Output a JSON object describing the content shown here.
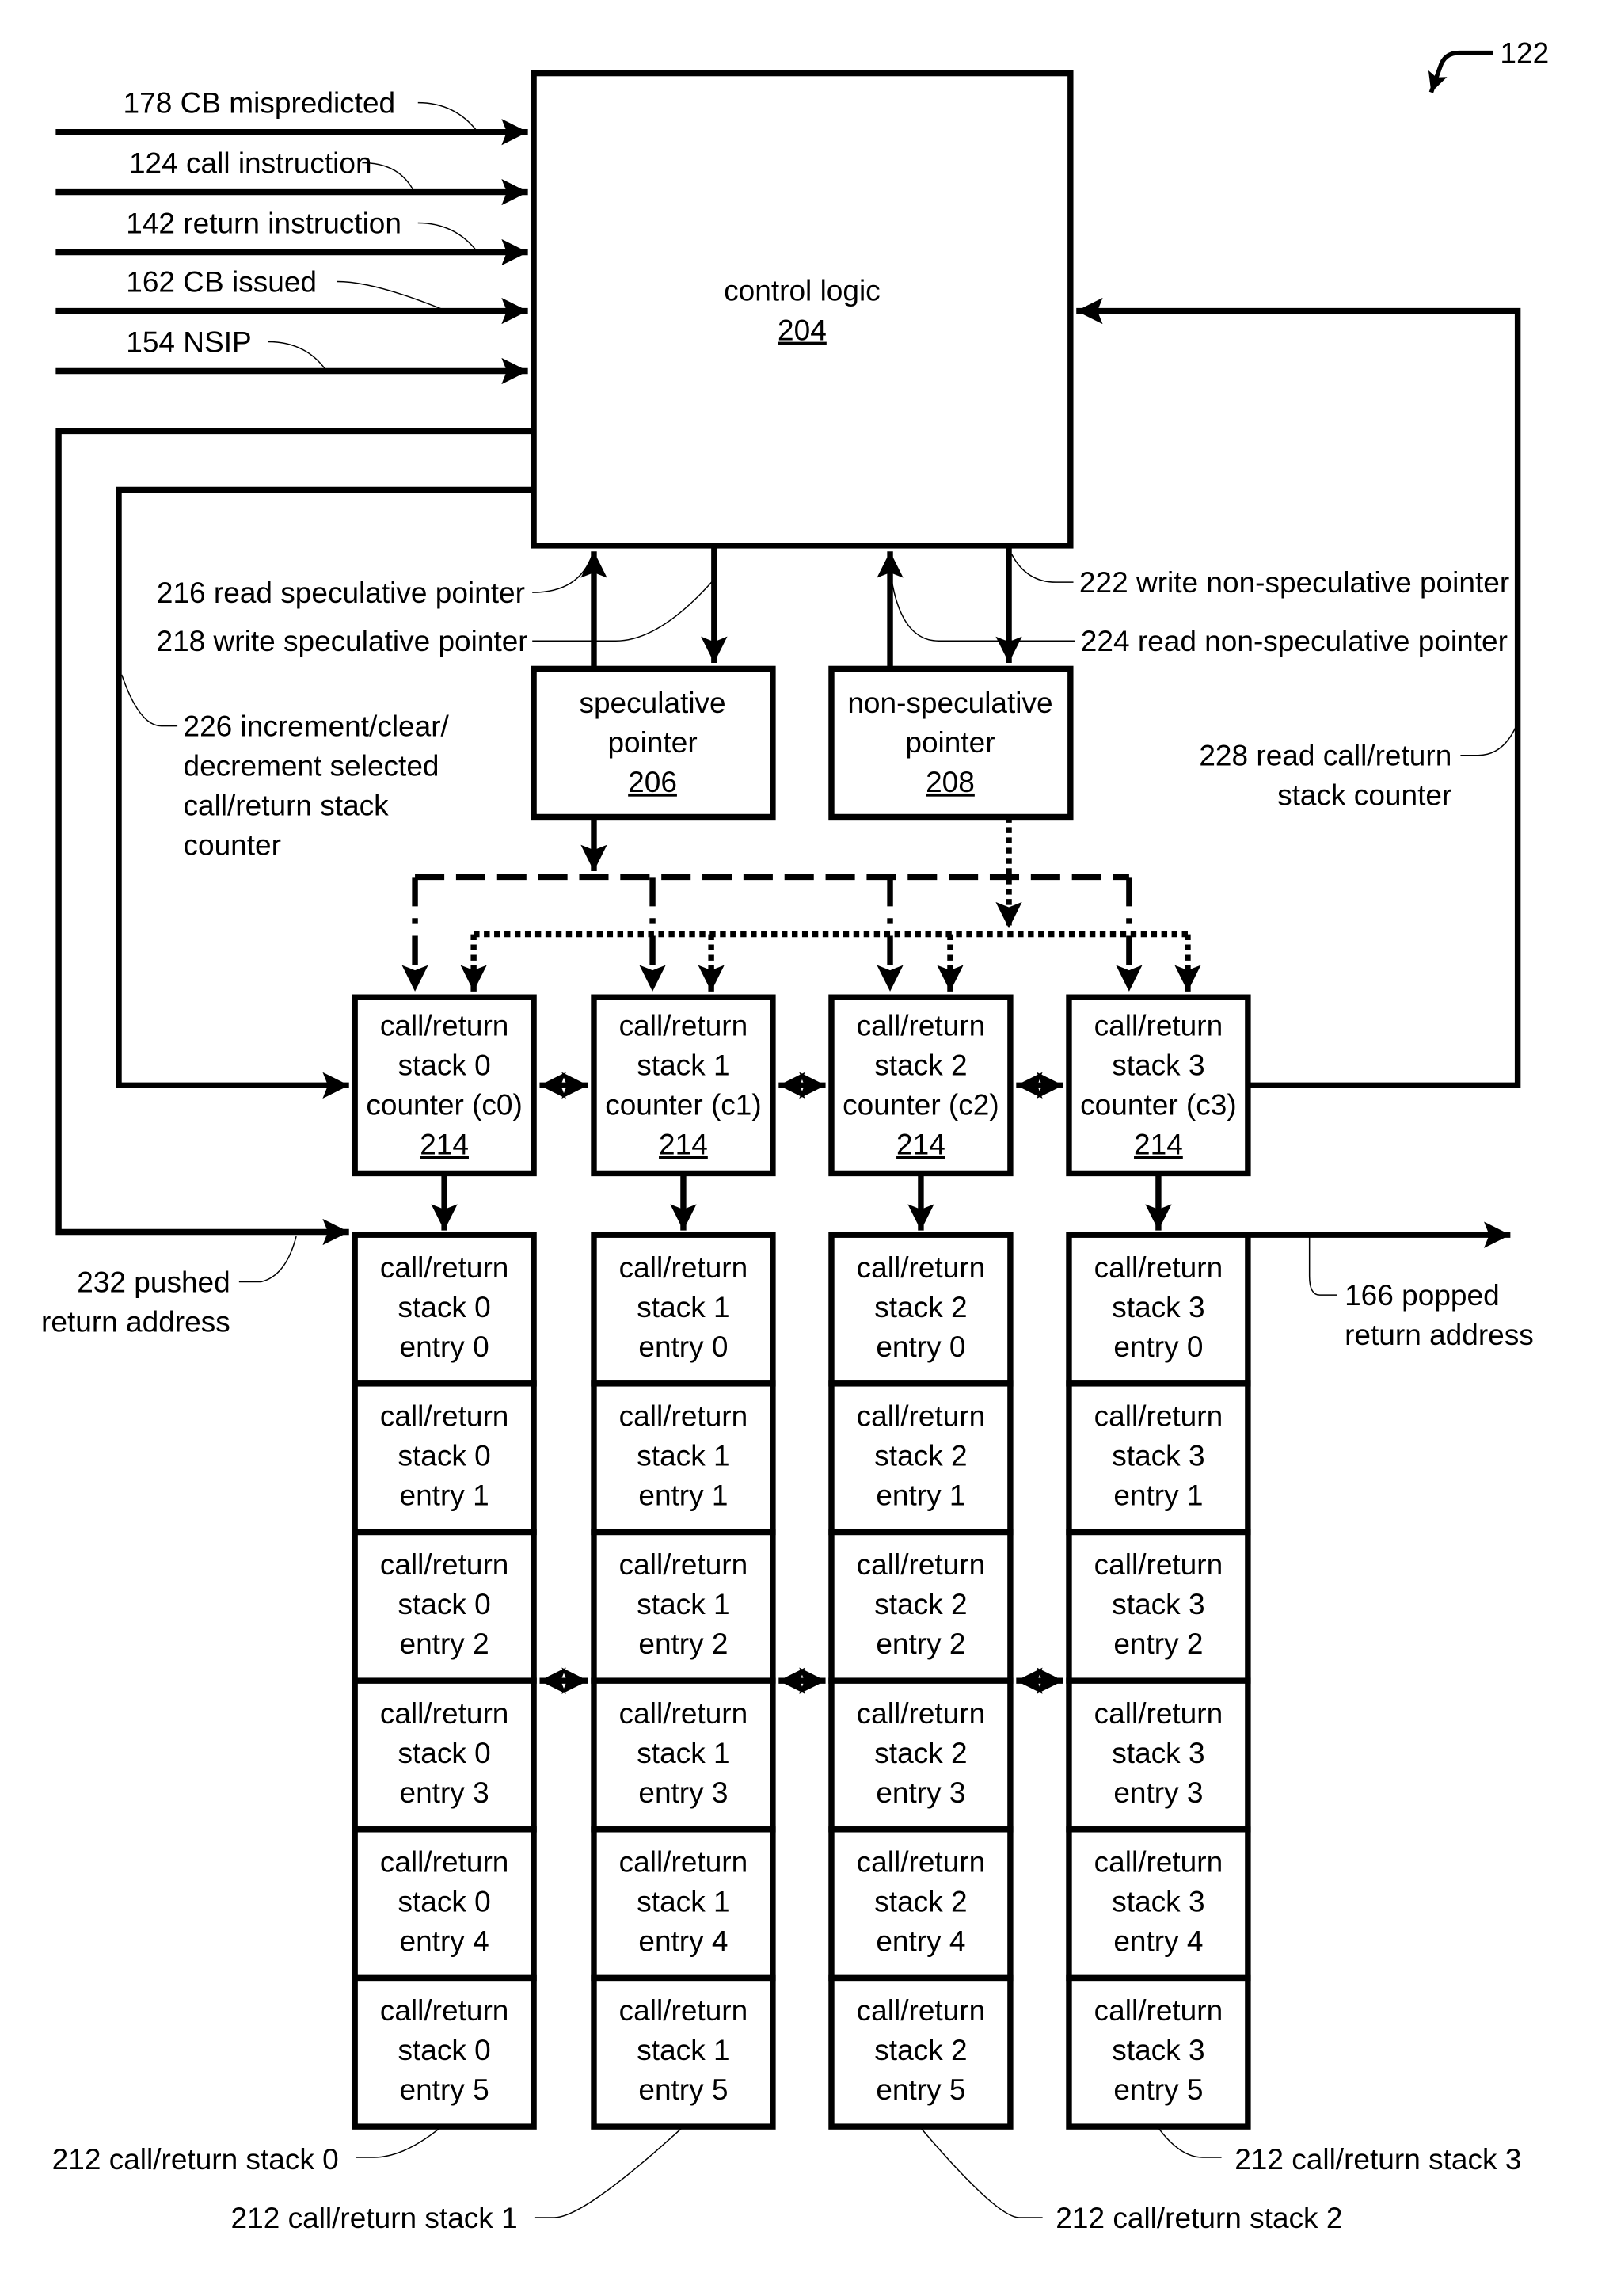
{
  "figure_ref": "122",
  "inputs": [
    {
      "ref": "178",
      "label": "178 CB mispredicted"
    },
    {
      "ref": "124",
      "label": "124 call instruction"
    },
    {
      "ref": "142",
      "label": "142 return instruction"
    },
    {
      "ref": "162",
      "label": "162 CB issued"
    },
    {
      "ref": "154",
      "label": "154 NSIP"
    }
  ],
  "control_logic": {
    "title": "control logic",
    "ref": "204"
  },
  "speculative_pointer": {
    "line1": "speculative",
    "line2": "pointer",
    "ref": "206"
  },
  "non_speculative_pointer": {
    "line1": "non-speculative",
    "line2": "pointer",
    "ref": "208"
  },
  "signals": {
    "read_spec": "216 read speculative pointer",
    "write_spec": "218 write speculative pointer",
    "write_nonspec": "222 write non-speculative pointer",
    "read_nonspec": "224 read non-speculative pointer",
    "inc_clear_dec": [
      "226 increment/clear/",
      "decrement selected",
      "call/return stack",
      "counter"
    ],
    "read_counter": [
      "228 read call/return",
      "stack counter"
    ],
    "pushed": [
      "232 pushed",
      "return address"
    ],
    "popped": [
      "166 popped",
      "return address"
    ]
  },
  "counters": [
    {
      "line1": "call/return",
      "line2": "stack 0",
      "line3": "counter (c0)",
      "ref": "214"
    },
    {
      "line1": "call/return",
      "line2": "stack 1",
      "line3": "counter (c1)",
      "ref": "214"
    },
    {
      "line1": "call/return",
      "line2": "stack 2",
      "line3": "counter (c2)",
      "ref": "214"
    },
    {
      "line1": "call/return",
      "line2": "stack 3",
      "line3": "counter (c3)",
      "ref": "214"
    }
  ],
  "stacks": [
    {
      "label": "212 call/return stack 0",
      "entries": [
        [
          "call/return",
          "stack 0",
          "entry 0"
        ],
        [
          "call/return",
          "stack 0",
          "entry 1"
        ],
        [
          "call/return",
          "stack 0",
          "entry 2"
        ],
        [
          "call/return",
          "stack 0",
          "entry 3"
        ],
        [
          "call/return",
          "stack 0",
          "entry 4"
        ],
        [
          "call/return",
          "stack 0",
          "entry 5"
        ]
      ]
    },
    {
      "label": "212 call/return stack 1",
      "entries": [
        [
          "call/return",
          "stack 1",
          "entry 0"
        ],
        [
          "call/return",
          "stack 1",
          "entry 1"
        ],
        [
          "call/return",
          "stack 1",
          "entry 2"
        ],
        [
          "call/return",
          "stack 1",
          "entry 3"
        ],
        [
          "call/return",
          "stack 1",
          "entry 4"
        ],
        [
          "call/return",
          "stack 1",
          "entry 5"
        ]
      ]
    },
    {
      "label": "212 call/return stack 2",
      "entries": [
        [
          "call/return",
          "stack 2",
          "entry 0"
        ],
        [
          "call/return",
          "stack 2",
          "entry 1"
        ],
        [
          "call/return",
          "stack 2",
          "entry 2"
        ],
        [
          "call/return",
          "stack 2",
          "entry 3"
        ],
        [
          "call/return",
          "stack 2",
          "entry 4"
        ],
        [
          "call/return",
          "stack 2",
          "entry 5"
        ]
      ]
    },
    {
      "label": "212 call/return stack 3",
      "entries": [
        [
          "call/return",
          "stack 3",
          "entry 0"
        ],
        [
          "call/return",
          "stack 3",
          "entry 1"
        ],
        [
          "call/return",
          "stack 3",
          "entry 2"
        ],
        [
          "call/return",
          "stack 3",
          "entry 3"
        ],
        [
          "call/return",
          "stack 3",
          "entry 4"
        ],
        [
          "call/return",
          "stack 3",
          "entry 5"
        ]
      ]
    }
  ]
}
